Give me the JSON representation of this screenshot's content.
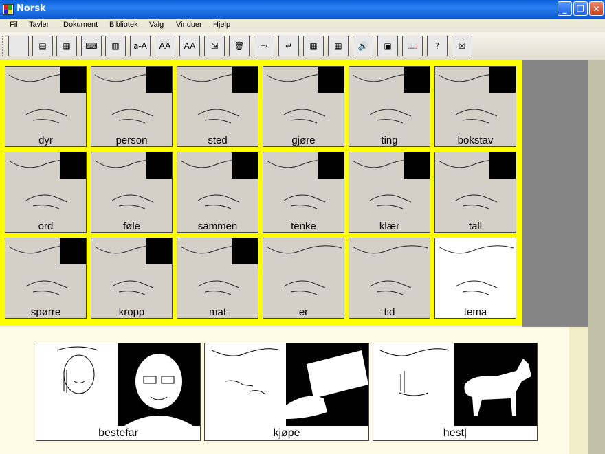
{
  "window": {
    "title": "Norsk"
  },
  "menu": [
    "Fil",
    "Tavler",
    "Dokument",
    "Bibliotek",
    "Valg",
    "Vinduer",
    "Hjelp"
  ],
  "toolbar": {
    "buttons": [
      {
        "name": "new-icon",
        "glyph": ""
      },
      {
        "name": "print-setup-icon",
        "glyph": "▤"
      },
      {
        "name": "save-icon",
        "glyph": "▦"
      },
      {
        "name": "keyboard-icon",
        "glyph": "⌨"
      },
      {
        "name": "calculator-icon",
        "glyph": "▥"
      },
      {
        "name": "lowercase-uppercase-icon",
        "glyph": "a-A"
      },
      {
        "name": "font-size-up-icon",
        "glyph": "AA"
      },
      {
        "name": "font-size-down-icon",
        "glyph": "AA"
      },
      {
        "name": "insert-icon",
        "glyph": "⇲"
      },
      {
        "name": "trash-icon",
        "glyph": "🗑"
      },
      {
        "name": "move-right-icon",
        "glyph": "⇨"
      },
      {
        "name": "enter-icon",
        "glyph": "↵"
      },
      {
        "name": "grid-small-icon",
        "glyph": "▦"
      },
      {
        "name": "grid-large-icon",
        "glyph": "▦"
      },
      {
        "name": "speaker-icon",
        "glyph": "🔊"
      },
      {
        "name": "scanner-icon",
        "glyph": "▣"
      },
      {
        "name": "book-icon",
        "glyph": "📖"
      },
      {
        "name": "help-icon",
        "glyph": "?"
      },
      {
        "name": "no-grid-icon",
        "glyph": "☒"
      }
    ]
  },
  "grid": [
    [
      "dyr",
      "person",
      "sted",
      "gjøre",
      "ting",
      "bokstav"
    ],
    [
      "ord",
      "føle",
      "sammen",
      "tenke",
      "klær",
      "tall"
    ],
    [
      "spørre",
      "kropp",
      "mat",
      "er",
      "tid",
      "tema"
    ]
  ],
  "sentence": [
    "bestefar",
    "kjøpe",
    "hest|"
  ],
  "colors": {
    "gridBackground": "#ffff00",
    "cell": "#d4d0c8",
    "titlebar": "#0a5fd8",
    "bottom": "#fffbe6"
  }
}
